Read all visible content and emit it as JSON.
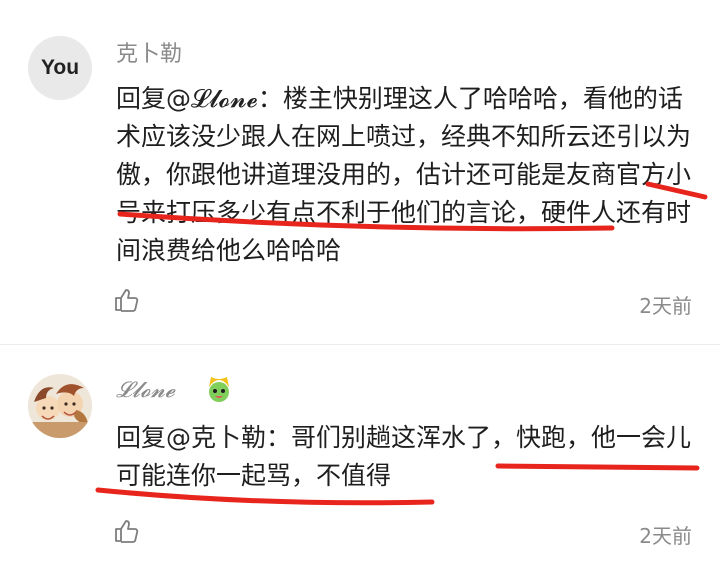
{
  "comments": [
    {
      "avatar_text": "You",
      "username": "克卜勒",
      "reply_prefix": "回复",
      "mention": "@𝓛𝓵𝓸𝓷𝓮",
      "text": "：楼主快别理这人了哈哈哈，看他的话术应该没少跟人在网上喷过，经典不知所云还引以为傲，你跟他讲道理没用的，估计还可能是友商官方小号来打压多少有点不利于他们的言论，硬件人还有时间浪费给他么哈哈哈",
      "time": "2天前"
    },
    {
      "username": "𝓛𝓵𝓸𝓷𝓮",
      "reply_prefix": "回复",
      "mention": "@克卜勒",
      "text": "：哥们别趟这浑水了，快跑，他一会儿可能连你一起骂，不值得",
      "time": "2天前"
    }
  ],
  "colors": {
    "underline": "#e8251d",
    "meta_text": "#8a8a8a",
    "avatar_bg": "#e9e9e9"
  },
  "icons": [
    "like-icon",
    "thumbs-up-icon",
    "green-badge-icon"
  ]
}
